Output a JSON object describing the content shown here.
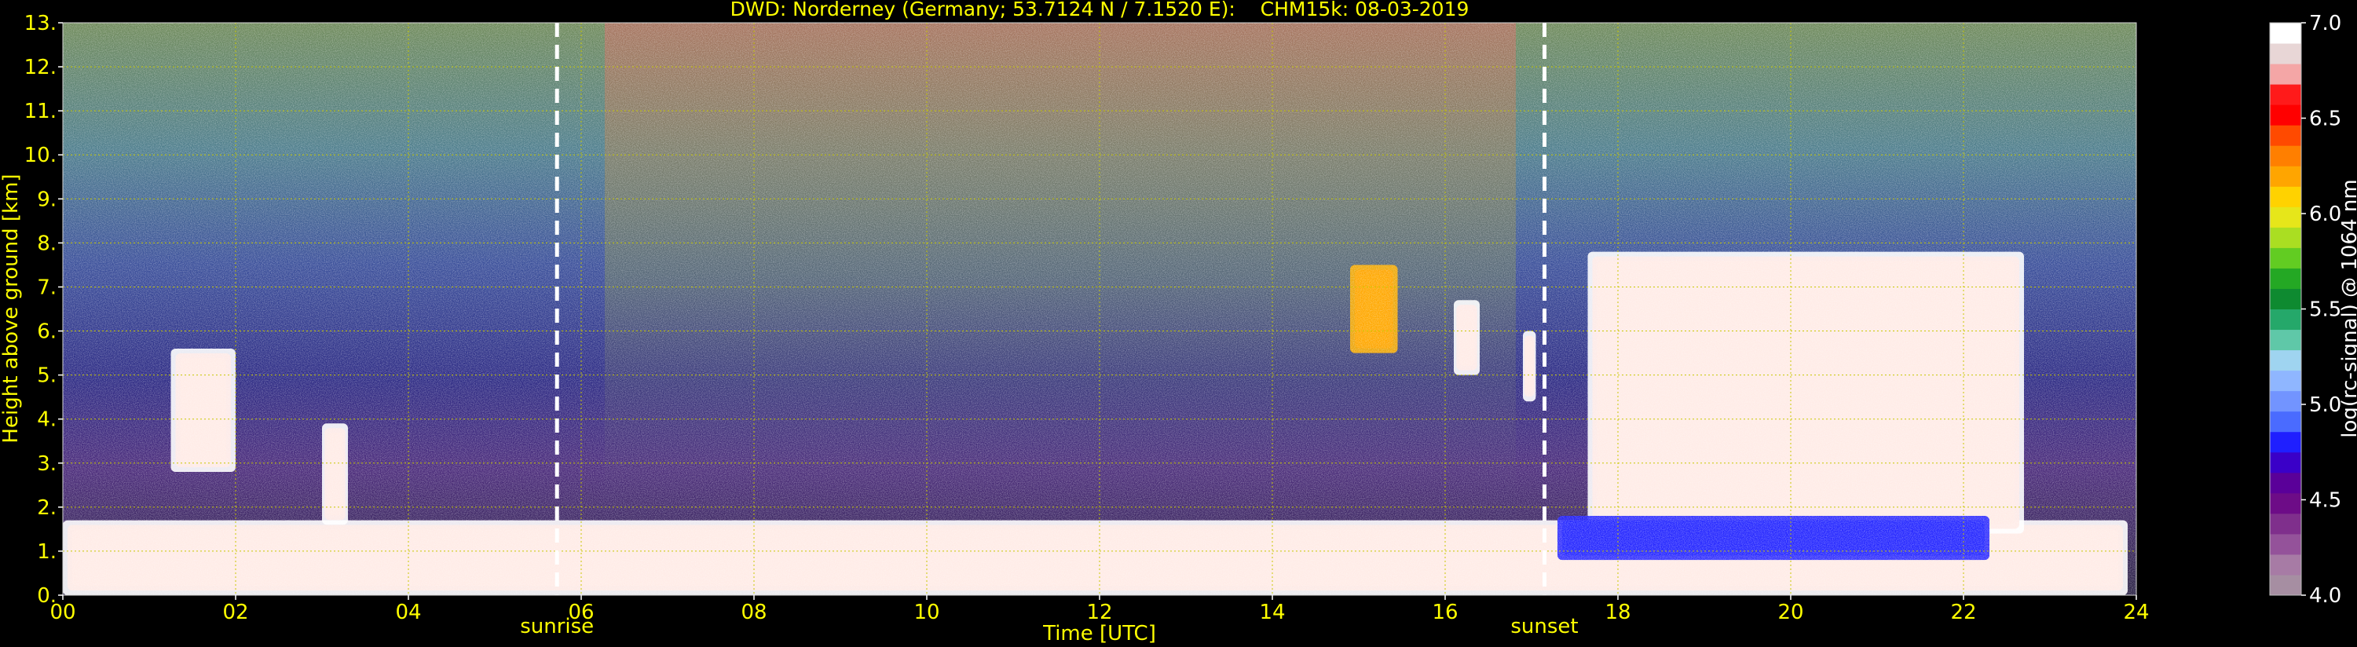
{
  "chart_data": {
    "type": "heatmap",
    "title": "DWD: Norderney (Germany; 53.7124 N / 7.1520 E):    CHM15k: 08-03-2019",
    "xlabel": "Time [UTC]",
    "ylabel": "Height above ground [km]",
    "xlim": [
      0,
      24
    ],
    "ylim": [
      0,
      13
    ],
    "x_ticks": [
      "00",
      "02",
      "04",
      "06",
      "08",
      "10",
      "12",
      "14",
      "16",
      "18",
      "20",
      "22",
      "24"
    ],
    "y_ticks": [
      "0.",
      "1.",
      "2.",
      "3.",
      "4.",
      "5.",
      "6.",
      "7.",
      "8.",
      "9.",
      "10.",
      "11.",
      "12.",
      "13."
    ],
    "grid": true,
    "annotations": [
      {
        "label": "sunrise",
        "x": 5.72
      },
      {
        "label": "sunset",
        "x": 17.15
      }
    ],
    "colorbar": {
      "label": "log(rc-signal) @ 1064 nm",
      "range": [
        4.0,
        7.0
      ],
      "ticks": [
        "4.0",
        "4.5",
        "5.0",
        "5.5",
        "6.0",
        "6.5",
        "7.0"
      ],
      "colors": [
        "#a68ea2",
        "#a77ba5",
        "#94529a",
        "#7f2f8c",
        "#6d0c87",
        "#5a0099",
        "#3a00c8",
        "#1f1fff",
        "#4a6bff",
        "#7294ff",
        "#8fb6ff",
        "#9fd4f0",
        "#5fc8a8",
        "#25a86a",
        "#0e8a30",
        "#24a824",
        "#62cc22",
        "#aade22",
        "#e6e61a",
        "#ffd200",
        "#ffa500",
        "#ff7f00",
        "#ff4a00",
        "#ff0000",
        "#ff1a1a",
        "#f4a6a6",
        "#e8d6d6",
        "#ffffff"
      ]
    },
    "features": [
      {
        "kind": "boundary-layer-aerosol",
        "time": [
          0.0,
          23.9
        ],
        "height_km": [
          0.0,
          1.7
        ],
        "signal": "high"
      },
      {
        "kind": "cloud",
        "time": [
          1.25,
          2.0
        ],
        "height_km": [
          2.8,
          5.6
        ],
        "signal": "high"
      },
      {
        "kind": "cloud",
        "time": [
          3.0,
          3.3
        ],
        "height_km": [
          1.6,
          3.9
        ],
        "signal": "high"
      },
      {
        "kind": "cloud",
        "time": [
          14.9,
          15.45
        ],
        "height_km": [
          5.5,
          7.5
        ],
        "signal": "medium"
      },
      {
        "kind": "cloud",
        "time": [
          16.1,
          16.4
        ],
        "height_km": [
          5.0,
          6.7
        ],
        "signal": "high"
      },
      {
        "kind": "cloud",
        "time": [
          16.9,
          17.05
        ],
        "height_km": [
          4.4,
          6.0
        ],
        "signal": "high"
      },
      {
        "kind": "cloud",
        "time": [
          17.65,
          22.7
        ],
        "height_km": [
          1.4,
          7.8
        ],
        "signal": "high"
      },
      {
        "kind": "residual-layer",
        "time": [
          17.3,
          22.3
        ],
        "height_km": [
          0.8,
          1.8
        ],
        "signal": "low"
      }
    ]
  }
}
